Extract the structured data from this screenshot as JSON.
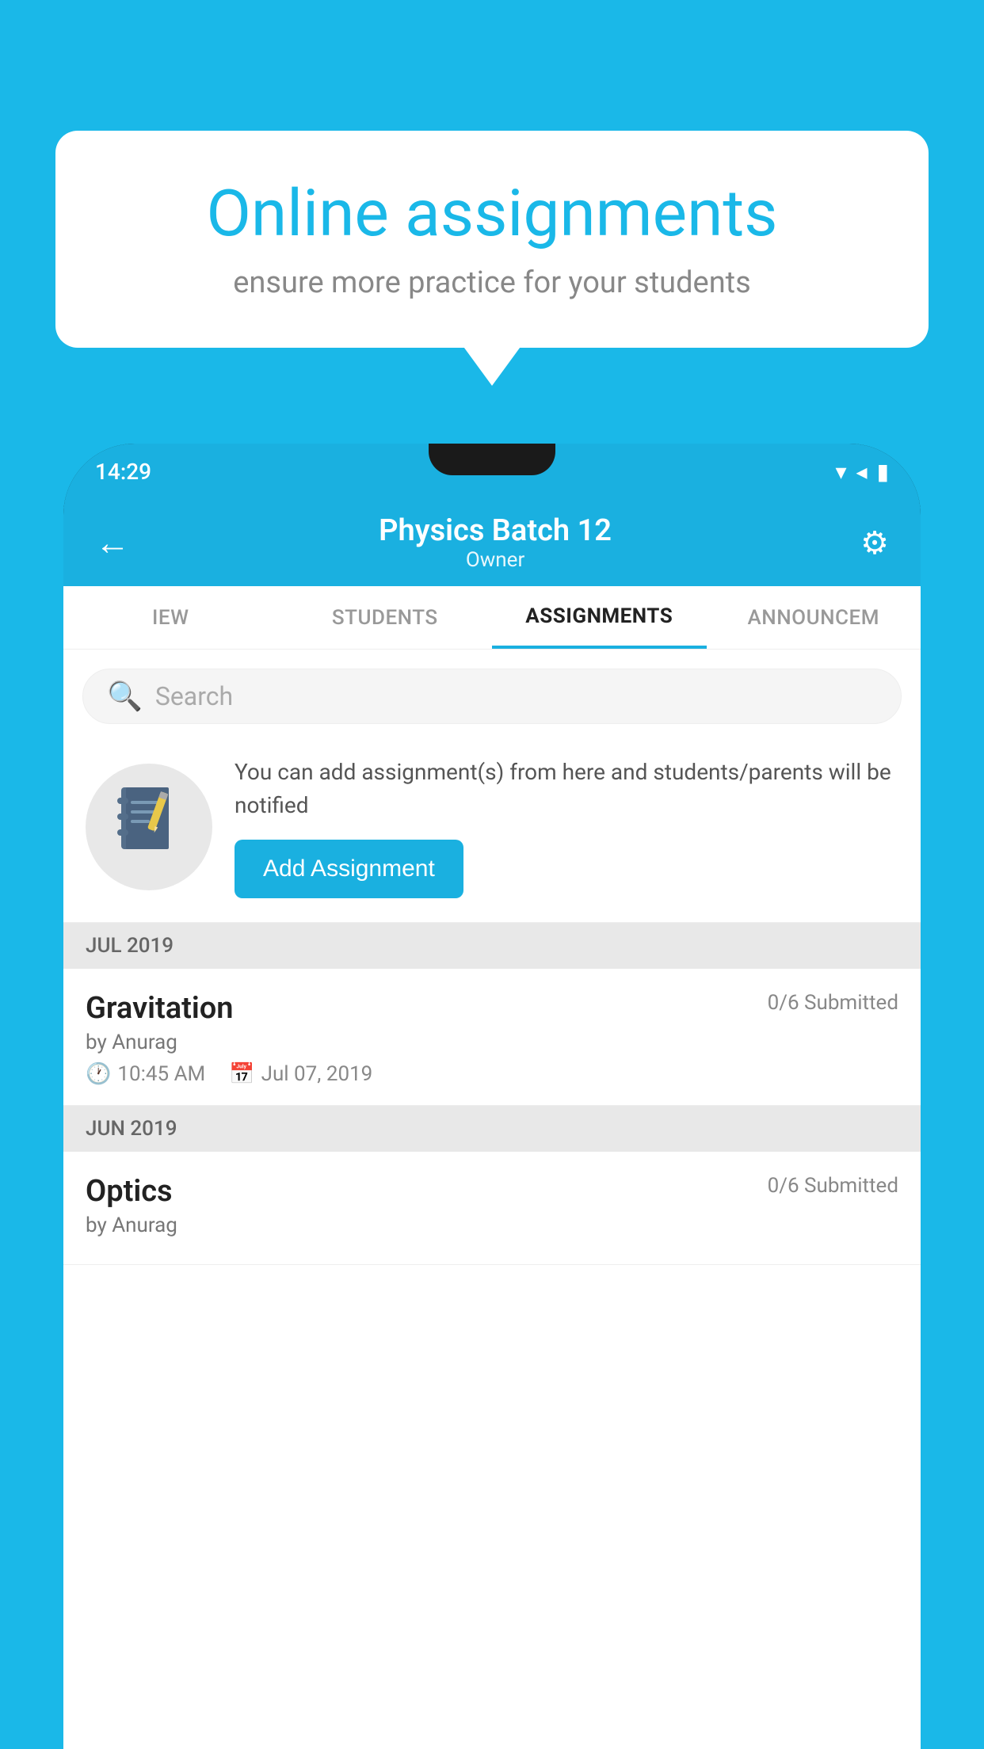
{
  "background_color": "#1ab8e8",
  "speech_bubble": {
    "title": "Online assignments",
    "subtitle": "ensure more practice for your students"
  },
  "phone": {
    "status_bar": {
      "time": "14:29",
      "icons": "▾◂▮"
    },
    "app_bar": {
      "title": "Physics Batch 12",
      "subtitle": "Owner",
      "back_icon": "←",
      "settings_icon": "⚙"
    },
    "tabs": [
      {
        "label": "IEW",
        "active": false
      },
      {
        "label": "STUDENTS",
        "active": false
      },
      {
        "label": "ASSIGNMENTS",
        "active": true
      },
      {
        "label": "ANNOUNCEM",
        "active": false
      }
    ],
    "search": {
      "placeholder": "Search"
    },
    "promo": {
      "icon": "📓",
      "text": "You can add assignment(s) from here and students/parents will be notified",
      "button_label": "Add Assignment"
    },
    "sections": [
      {
        "header": "JUL 2019",
        "items": [
          {
            "name": "Gravitation",
            "submitted": "0/6 Submitted",
            "by": "by Anurag",
            "time": "10:45 AM",
            "date": "Jul 07, 2019"
          }
        ]
      },
      {
        "header": "JUN 2019",
        "items": [
          {
            "name": "Optics",
            "submitted": "0/6 Submitted",
            "by": "by Anurag",
            "time": "",
            "date": ""
          }
        ]
      }
    ]
  }
}
